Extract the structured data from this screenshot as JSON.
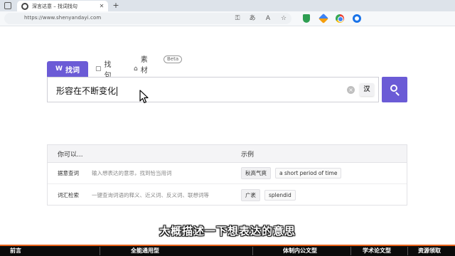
{
  "browser": {
    "tab_title": "深言达意 – 找词找句",
    "tab_close": "✕",
    "new_tab": "+",
    "url": "https://www.shenyandayi.com",
    "toolbar_icons": [
      "key-icon",
      "translate-icon",
      "read-aloud-icon",
      "favorite-icon",
      "shield-icon",
      "translator-icon",
      "chrome-icon",
      "blue-circle-icon"
    ]
  },
  "site": {
    "tabs": [
      {
        "icon": "W",
        "label": "找词"
      },
      {
        "icon": "▢",
        "label": "找句"
      },
      {
        "icon": "⌂",
        "label": "素材库"
      }
    ],
    "beta_badge": "Beta",
    "query": "形容在不断变化",
    "clear": "×",
    "lang_toggle": "汉"
  },
  "examples": {
    "header_left": "你可以...",
    "header_right": "示例",
    "rows": [
      {
        "name": "据意查词",
        "desc": "输入想表达的意思，找到恰当用词",
        "examples": [
          "秋高气爽",
          "a short period of time"
        ]
      },
      {
        "name": "词汇检索",
        "desc": "一键查询词语的释义、近义词、反义词、联想词等",
        "examples": [
          "广袤",
          "splendid"
        ]
      }
    ]
  },
  "subtitle": "大概描述一下想表达的意思",
  "bottom_bar": [
    "前言",
    "全能通用型",
    "体制内公文型",
    "学术论文型",
    "资源领取"
  ],
  "colors": {
    "accent": "#6b5bd6",
    "bar_border": "#e7621a"
  }
}
